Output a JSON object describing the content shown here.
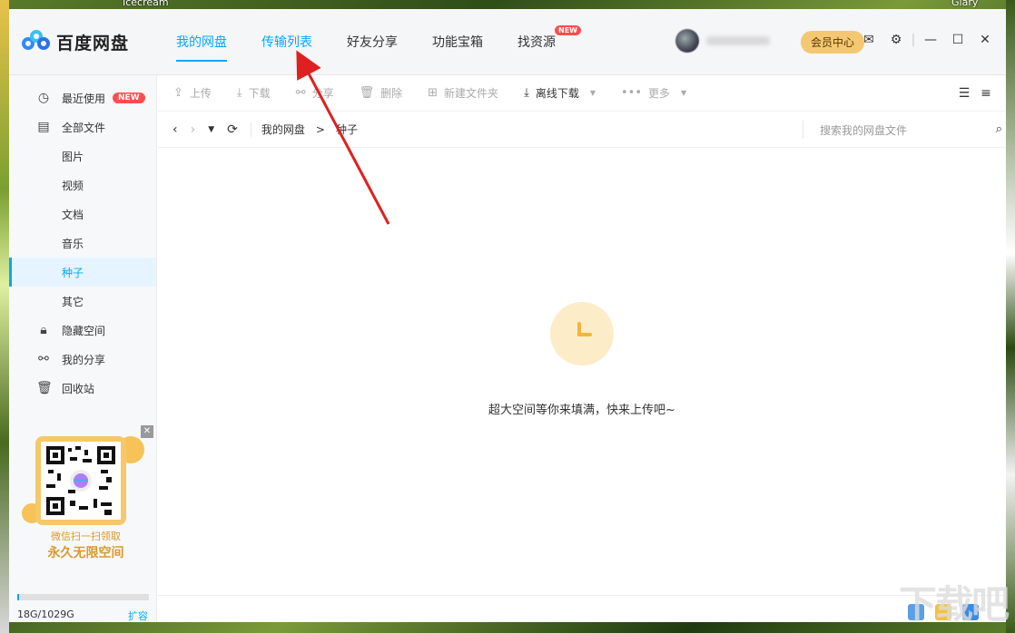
{
  "desktop": {
    "top_label": "Icecream",
    "top_right_label": "Glary"
  },
  "app": {
    "title": "百度网盘"
  },
  "nav": {
    "tabs": [
      {
        "label": "我的网盘"
      },
      {
        "label": "传输列表"
      },
      {
        "label": "好友分享"
      },
      {
        "label": "功能宝箱"
      },
      {
        "label": "找资源",
        "badge": "NEW"
      }
    ]
  },
  "user": {
    "vip_label": "会员中心"
  },
  "sidebar": {
    "items": [
      {
        "label": "最近使用",
        "badge": "NEW"
      },
      {
        "label": "全部文件"
      },
      {
        "label": "图片"
      },
      {
        "label": "视频"
      },
      {
        "label": "文档"
      },
      {
        "label": "音乐"
      },
      {
        "label": "种子"
      },
      {
        "label": "其它"
      },
      {
        "label": "隐藏空间"
      },
      {
        "label": "我的分享"
      },
      {
        "label": "回收站"
      }
    ],
    "promo": {
      "line1": "微信扫一扫领取",
      "line2": "永久无限空间"
    },
    "quota": {
      "text": "18G/1029G",
      "expand_label": "扩容",
      "used_fraction": 0.017
    }
  },
  "toolbar": {
    "upload": "上传",
    "download": "下载",
    "share": "分享",
    "delete": "删除",
    "new_folder": "新建文件夹",
    "offline_download": "离线下载",
    "more": "更多"
  },
  "path": {
    "root": "我的网盘",
    "separator": ">",
    "current": "种子",
    "search_placeholder": "搜索我的网盘文件"
  },
  "empty": {
    "message": "超大空间等你来填满，快来上传吧~"
  },
  "watermark": {
    "text": "下载吧"
  },
  "colors": {
    "accent": "#06a7ff",
    "badge": "#ff4d4f",
    "vip": "#f4c872",
    "annotation": "#e02020"
  }
}
